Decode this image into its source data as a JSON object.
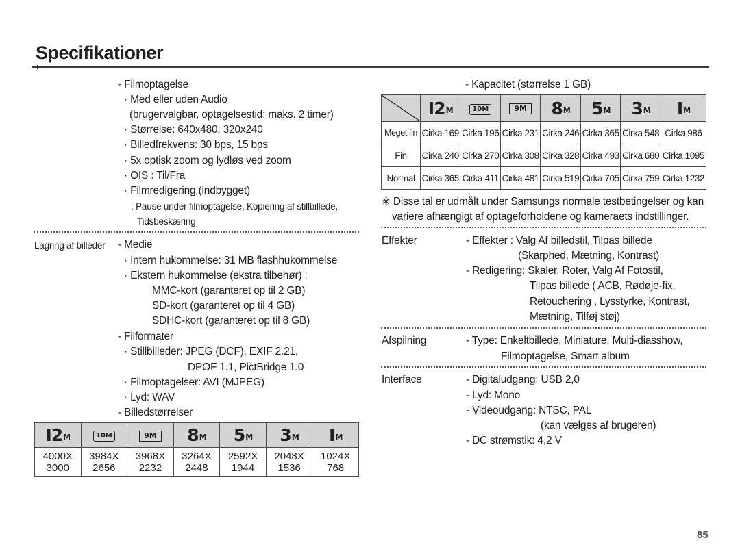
{
  "page": {
    "title": "Specifikationer",
    "page_number": "85"
  },
  "left": {
    "film": {
      "heading": "- Filmoptagelse",
      "lines": [
        "· Med eller uden Audio",
        "(brugervalgbar, optagelsestid: maks. 2 timer)",
        "· Størrelse: 640x480, 320x240",
        "· Billedfrekvens: 30 bps, 15 bps",
        "· 5x optisk zoom og lydløs ved zoom",
        "· OIS : Til/Fra",
        "· Filmredigering (indbygget)",
        ": Pause under filmoptagelse, Kopiering af stillbillede,",
        "Tidsbeskæring"
      ]
    },
    "storage": {
      "label": "Lagring af billeder",
      "media_heading": "- Medie",
      "media_lines": [
        "· Intern hukommelse: 31 MB flashhukommelse",
        "· Ekstern hukommelse (ekstra tilbehør) :",
        "MMC-kort (garanteret op til 2 GB)",
        "SD-kort (garanteret op til 4 GB)",
        "SDHC-kort (garanteret op til 8 GB)"
      ],
      "formats_heading": "- Filformater",
      "format_lines": [
        "· Stillbilleder: JPEG (DCF), EXIF 2.21,",
        "DPOF 1.1, PictBridge 1.0",
        "· Filmoptagelser: AVI (MJPEG)",
        "· Lyd: WAV"
      ],
      "sizes_heading": "- Billedstørrelser"
    },
    "size_table": {
      "icons": [
        {
          "name": "12m-icon",
          "label": "12",
          "suffix": "M",
          "style": "plain"
        },
        {
          "name": "10m-wide-icon",
          "label": "10M",
          "style": "folded"
        },
        {
          "name": "9m-panorama-icon",
          "label": "9M",
          "style": "wide"
        },
        {
          "name": "8m-icon",
          "label": "8",
          "suffix": "M",
          "style": "plain"
        },
        {
          "name": "5m-icon",
          "label": "5",
          "suffix": "M",
          "style": "plain"
        },
        {
          "name": "3m-icon",
          "label": "3",
          "suffix": "M",
          "style": "plain"
        },
        {
          "name": "1m-icon",
          "label": "I",
          "suffix": "M",
          "style": "plain"
        }
      ],
      "widths": [
        "4000X",
        "3984X",
        "3968X",
        "3264X",
        "2592X",
        "2048X",
        "1024X"
      ],
      "heights": [
        "3000",
        "2656",
        "2232",
        "2448",
        "1944",
        "1536",
        "768"
      ]
    }
  },
  "right": {
    "capacity": {
      "heading": "- Kapacitet (størrelse 1 GB)",
      "rows": [
        {
          "label": "Meget fin",
          "values": [
            "Cirka 169",
            "Cirka 196",
            "Cirka 231",
            "Cirka 246",
            "Cirka 365",
            "Cirka 548",
            "Cirka 986"
          ]
        },
        {
          "label": "Fin",
          "values": [
            "Cirka 240",
            "Cirka 270",
            "Cirka 308",
            "Cirka 328",
            "Cirka 493",
            "Cirka 680",
            "Cirka 1095"
          ]
        },
        {
          "label": "Normal",
          "values": [
            "Cirka 365",
            "Cirka 411",
            "Cirka 481",
            "Cirka 519",
            "Cirka 705",
            "Cirka 759",
            "Cirka 1232"
          ]
        }
      ],
      "note_line1": "※ Disse tal er udmålt under Samsungs normale testbetingelser og kan",
      "note_line2": "variere afhængigt af optageforholdene og kameraets indstillinger."
    },
    "effects": {
      "label": "Effekter",
      "lines": [
        "- Effekter : Valg Af billedstil, Tilpas billede",
        "(Skarphed, Mætning, Kontrast)",
        "- Redigering: Skaler, Roter, Valg Af Fotostil,",
        "Tilpas billede ( ACB, Rødøje-fix,",
        "Retouchering , Lysstyrke, Kontrast,",
        "Mætning, Tilføj støj)"
      ]
    },
    "playback": {
      "label": "Afspilning",
      "lines": [
        "- Type: Enkeltbillede, Miniature, Multi-diasshow,",
        "Filmoptagelse, Smart album"
      ]
    },
    "interface": {
      "label": "Interface",
      "lines": [
        "- Digitaludgang: USB 2,0",
        "- Lyd: Mono",
        "- Videoudgang: NTSC, PAL",
        "(kan vælges af brugeren)",
        "- DC strømstik: 4,2 V"
      ]
    }
  }
}
